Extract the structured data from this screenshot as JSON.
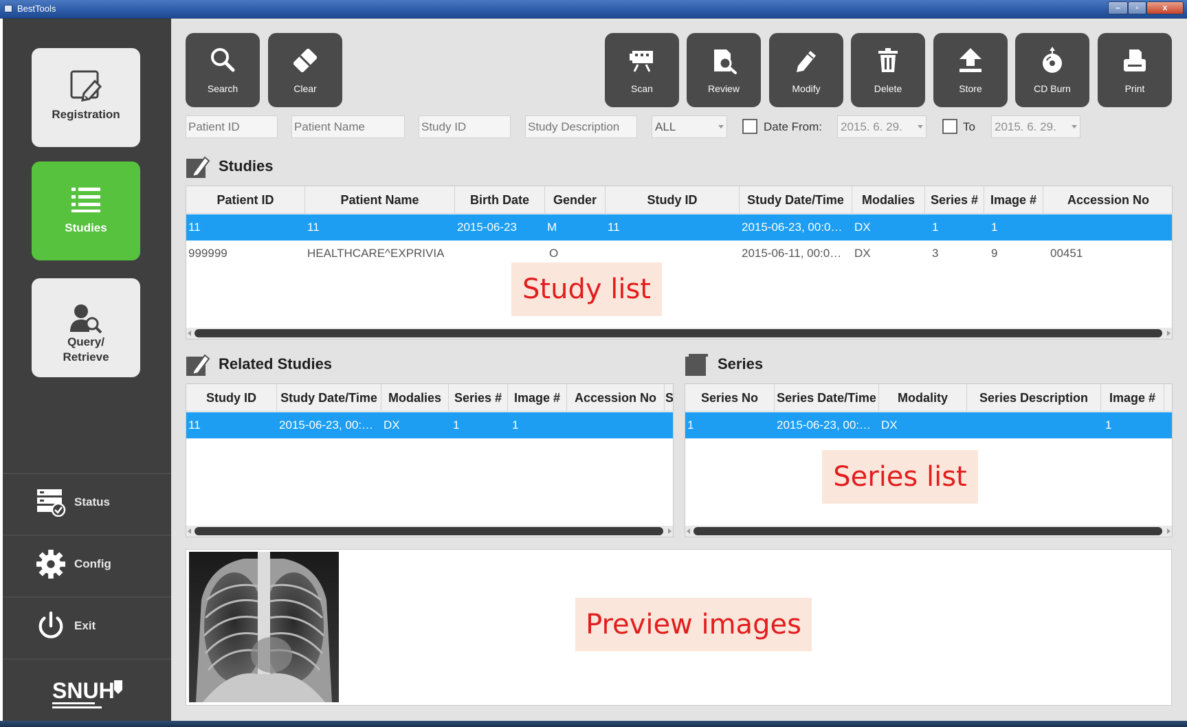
{
  "window": {
    "title": "BestTools",
    "controls": {
      "minimize": "–",
      "maximize": "▫",
      "close": "x"
    }
  },
  "sidebar": {
    "nav": [
      {
        "label": "Registration",
        "icon": "registration-edit-icon",
        "active": false
      },
      {
        "label": "Studies",
        "icon": "list-icon",
        "active": true
      },
      {
        "label_line1": "Query/",
        "label_line2": "Retrieve",
        "icon": "user-search-icon",
        "active": false
      }
    ],
    "bottom": [
      {
        "label": "Status",
        "icon": "status-server-check-icon"
      },
      {
        "label": "Config",
        "icon": "gear-icon"
      },
      {
        "label": "Exit",
        "icon": "power-icon"
      }
    ],
    "logo_text": "SNUH"
  },
  "toolbar": {
    "left": [
      {
        "label": "Search",
        "icon": "search-icon"
      },
      {
        "label": "Clear",
        "icon": "eraser-icon"
      }
    ],
    "right": [
      {
        "label": "Scan",
        "icon": "scan-camera-icon"
      },
      {
        "label": "Review",
        "icon": "review-magnifier-icon"
      },
      {
        "label": "Modify",
        "icon": "pencil-icon"
      },
      {
        "label": "Delete",
        "icon": "trash-icon"
      },
      {
        "label": "Store",
        "icon": "upload-arrow-icon"
      },
      {
        "label": "CD Burn",
        "icon": "cd-burn-icon"
      },
      {
        "label": "Print",
        "icon": "printer-icon"
      }
    ]
  },
  "filters": {
    "patient_id_placeholder": "Patient ID",
    "patient_name_placeholder": "Patient Name",
    "study_id_placeholder": "Study ID",
    "study_description_placeholder": "Study Description",
    "modality_value": "ALL",
    "date_from_label": "Date From:",
    "date_from_value": "2015. 6. 29.",
    "date_to_label": "To",
    "date_to_value": "2015. 6. 29.",
    "date_from_checked": false,
    "date_to_checked": false
  },
  "studies": {
    "title": "Studies",
    "columns": [
      "Patient ID",
      "Patient Name",
      "Birth Date",
      "Gender",
      "Study ID",
      "Study Date/Time",
      "Modalies",
      "Series #",
      "Image #",
      "Accession No"
    ],
    "rows": [
      {
        "selected": true,
        "cells": [
          "11",
          "11",
          "2015-06-23",
          "M",
          "11",
          "2015-06-23, 00:0…",
          "DX",
          "1",
          "1",
          ""
        ]
      },
      {
        "selected": false,
        "cells": [
          "999999",
          "HEALTHCARE^EXPRIVIA",
          "",
          "O",
          "",
          "2015-06-11, 00:0…",
          "DX",
          "3",
          "9",
          "00451"
        ]
      }
    ],
    "callout": "Study list"
  },
  "related": {
    "title": "Related Studies",
    "columns": [
      "Study ID",
      "Study Date/Time",
      "Modalies",
      "Series #",
      "Image #",
      "Accession No",
      "S"
    ],
    "rows": [
      {
        "selected": true,
        "cells": [
          "11",
          "2015-06-23, 00:…",
          "DX",
          "1",
          "1",
          "",
          ""
        ]
      }
    ]
  },
  "series": {
    "title": "Series",
    "columns": [
      "Series No",
      "Series Date/Time",
      "Modality",
      "Series Description",
      "Image #"
    ],
    "rows": [
      {
        "selected": true,
        "cells": [
          "1",
          "2015-06-23, 00:…",
          "DX",
          "",
          "1"
        ]
      }
    ],
    "callout": "Series list"
  },
  "preview": {
    "callout": "Preview images",
    "thumbnail": "chest-xray-thumbnail"
  },
  "colors": {
    "accent_green": "#56c23e",
    "selection_blue": "#1d9ef2",
    "sidebar_bg": "#3f3f3f",
    "button_bg": "#4a4a4a",
    "callout_text": "#e21d1d"
  }
}
